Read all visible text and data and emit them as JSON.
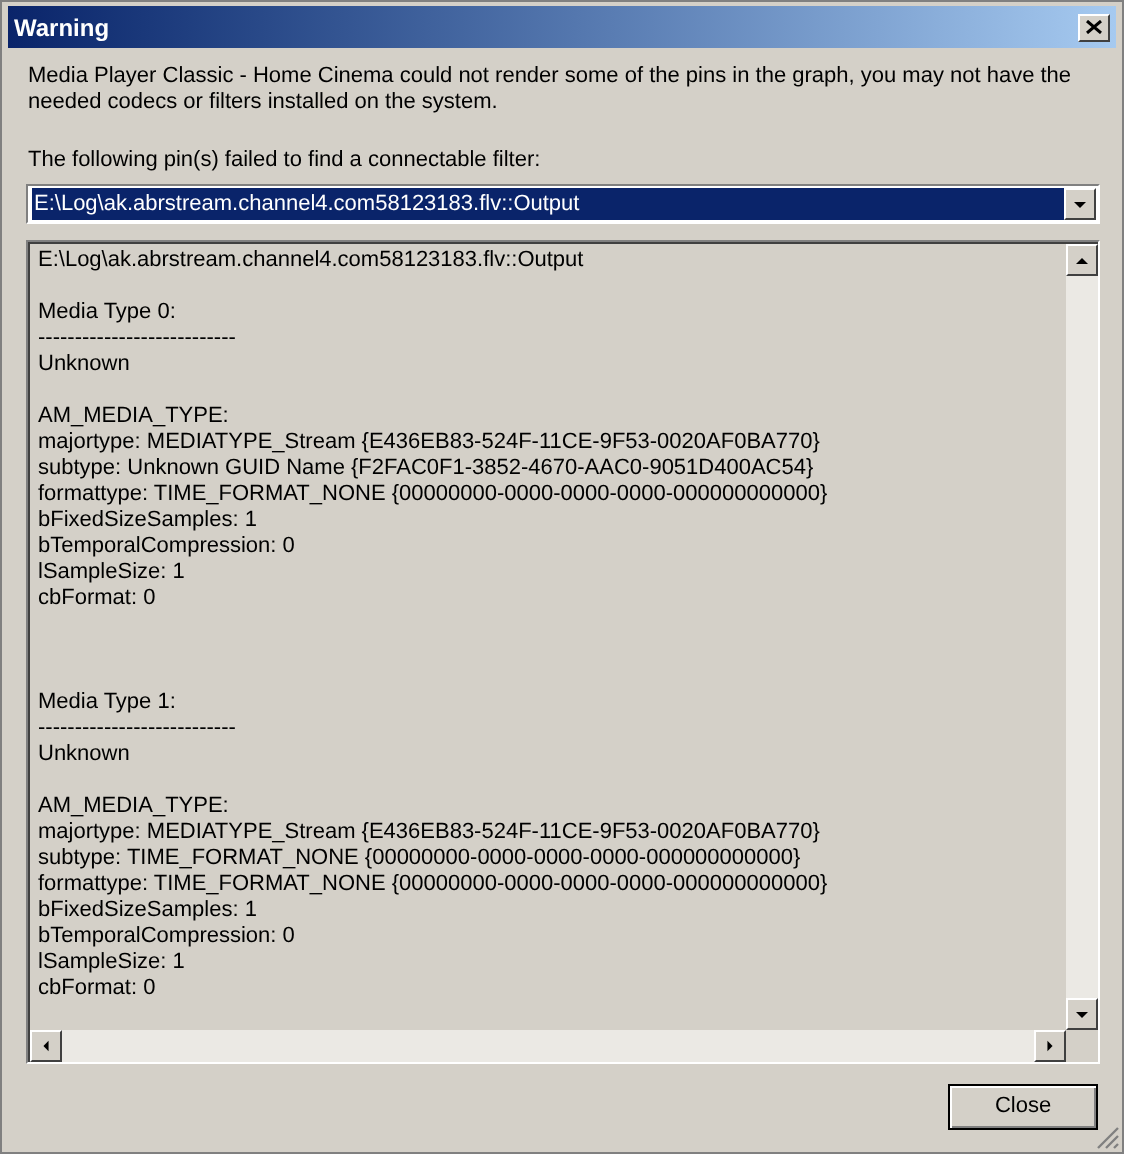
{
  "window": {
    "title": "Warning"
  },
  "message": "Media Player Classic - Home Cinema could not render some of the pins in the graph, you may not have the needed codecs or filters installed on the system.",
  "pins_label": "The following pin(s) failed to find a connectable filter:",
  "pin_dropdown": {
    "value": "E:\\Log\\ak.abrstream.channel4.com58123183.flv::Output"
  },
  "details": {
    "pin": "E:\\Log\\ak.abrstream.channel4.com58123183.flv::Output",
    "media_types": [
      {
        "heading": "Media Type 0:",
        "separator": "---------------------------",
        "type_name": "Unknown",
        "block_header": "AM_MEDIA_TYPE:",
        "lines": [
          "majortype: MEDIATYPE_Stream {E436EB83-524F-11CE-9F53-0020AF0BA770}",
          "subtype: Unknown GUID Name {F2FAC0F1-3852-4670-AAC0-9051D400AC54}",
          "formattype: TIME_FORMAT_NONE {00000000-0000-0000-0000-000000000000}",
          "bFixedSizeSamples: 1",
          "bTemporalCompression: 0",
          "lSampleSize: 1",
          "cbFormat: 0"
        ]
      },
      {
        "heading": "Media Type 1:",
        "separator": "---------------------------",
        "type_name": "Unknown",
        "block_header": "AM_MEDIA_TYPE:",
        "lines": [
          "majortype: MEDIATYPE_Stream {E436EB83-524F-11CE-9F53-0020AF0BA770}",
          "subtype: TIME_FORMAT_NONE {00000000-0000-0000-0000-000000000000}",
          "formattype: TIME_FORMAT_NONE {00000000-0000-0000-0000-000000000000}",
          "bFixedSizeSamples: 1",
          "bTemporalCompression: 0",
          "lSampleSize: 1",
          "cbFormat: 0"
        ]
      }
    ]
  },
  "buttons": [
    "Close"
  ]
}
